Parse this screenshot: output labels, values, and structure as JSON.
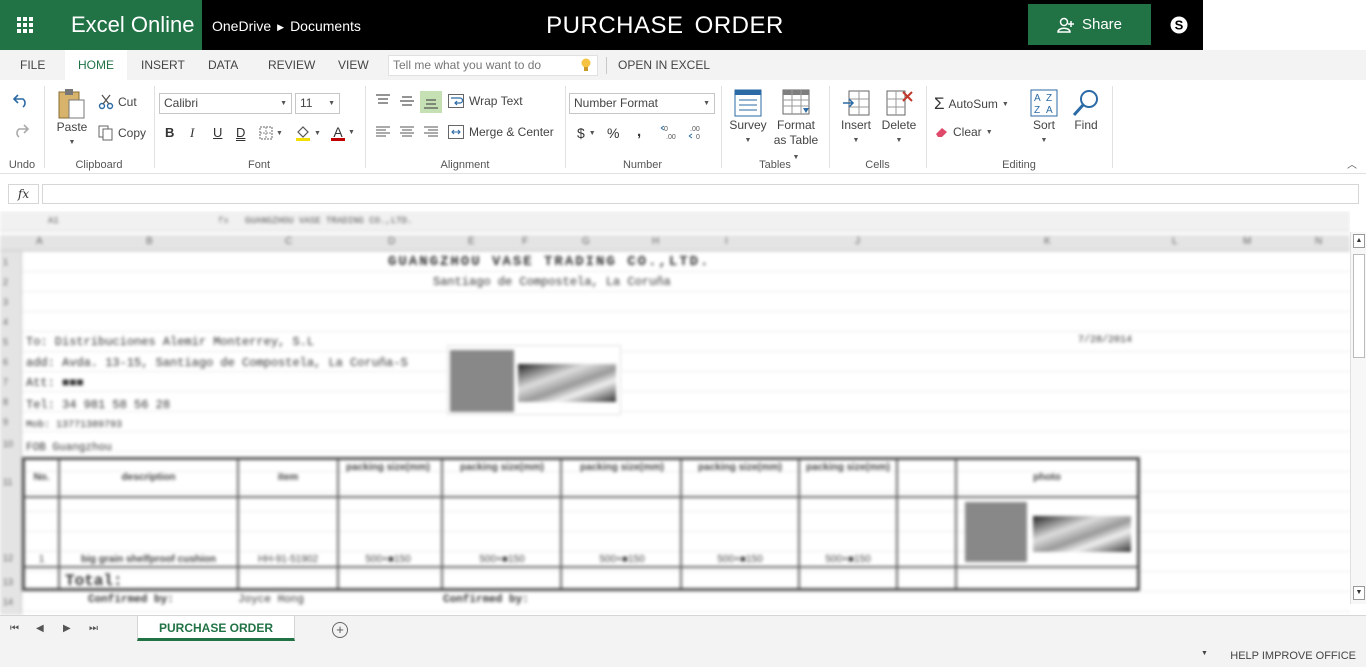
{
  "app": {
    "name": "Excel Online",
    "breadcrumb": [
      "OneDrive",
      "Documents"
    ],
    "doc_title": "PURCHASE  ORDER",
    "share_label": "Share"
  },
  "tabs": [
    {
      "label": "FILE"
    },
    {
      "label": "HOME",
      "active": true
    },
    {
      "label": "INSERT"
    },
    {
      "label": "DATA"
    },
    {
      "label": "REVIEW"
    },
    {
      "label": "VIEW"
    },
    {
      "label": "OPEN IN EXCEL"
    }
  ],
  "tell_me": {
    "placeholder": "Tell me what you want to do"
  },
  "ribbon": {
    "groups": {
      "undo": "Undo",
      "clipboard": "Clipboard",
      "font": "Font",
      "alignment": "Alignment",
      "number": "Number",
      "tables": "Tables",
      "cells": "Cells",
      "editing": "Editing"
    },
    "paste": "Paste",
    "cut": "Cut",
    "copy": "Copy",
    "font_name": "Calibri",
    "font_size": "11",
    "bold": "B",
    "italic": "I",
    "underline": "U",
    "double_underline": "D",
    "font_color_letter": "A",
    "wrap_text": "Wrap Text",
    "merge_center": "Merge & Center",
    "number_format": "Number Format",
    "currency": "$",
    "percent": "%",
    "comma": ",",
    "survey": "Survey",
    "format_as_table_1": "Format",
    "format_as_table_2": "as Table",
    "insert": "Insert",
    "delete": "Delete",
    "autosum": "AutoSum",
    "clear": "Clear",
    "sort": "Sort",
    "find": "Find"
  },
  "formula_bar": {
    "fx": "fx",
    "value": ""
  },
  "sheet": {
    "name_box": "A1",
    "formula_preview": "GUANGZHOU VASE TRADING CO.,LTD.",
    "company": "GUANGZHOU VASE TRADING CO.,LTD.",
    "address": "Santiago de Compostela, La Coruña",
    "lines": [
      "To:  Distribuciones Alemir Monterrey, S.L",
      "add: Avda. 13-15, Santiago de Compostela, La Coruña-S",
      "Att:  ■■■",
      "Tel:  34 981 58 56 28",
      "Mob:  13771389793",
      "FOB  Guangzhou"
    ],
    "date": "7/28/2014",
    "headers": [
      "No.",
      "description",
      "item",
      "packing size(mm)",
      "packing size(mm)",
      "packing size(mm)",
      "packing size(mm)",
      "packing size(mm)",
      "",
      "photo"
    ],
    "row": [
      "1",
      "big grain shelfproof cushion",
      "HH-91-51902",
      "500×■150",
      "500×■150",
      "500×■150",
      "500×■150",
      "500×■150",
      "",
      ""
    ],
    "total": "Total:",
    "confirmed_by_1": "Confirmed by:",
    "confirmed_name": "Joyce Hong",
    "confirmed_by_2": "Confirmed by:"
  },
  "sheet_tabs": [
    {
      "label": "PURCHASE ORDER",
      "active": true
    }
  ],
  "status": {
    "help": "HELP IMPROVE OFFICE"
  },
  "colors": {
    "accent": "#217346",
    "titlebar": "#000000"
  }
}
